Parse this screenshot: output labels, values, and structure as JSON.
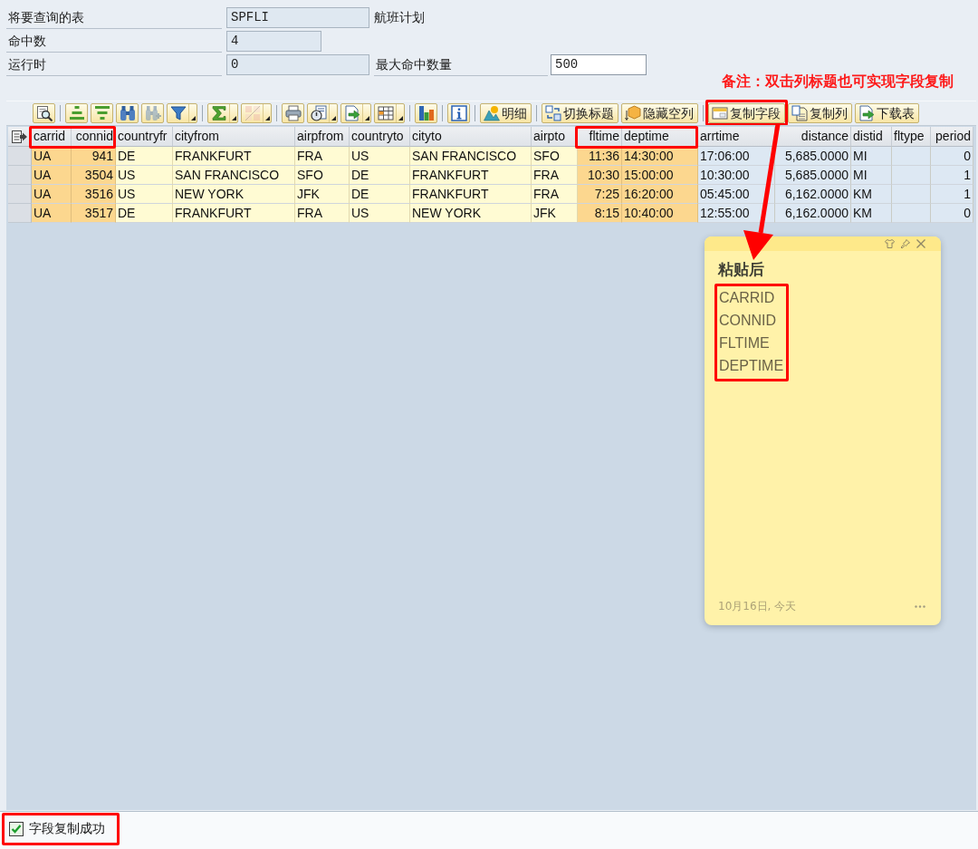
{
  "form": {
    "rows": [
      {
        "label": "将要查询的表",
        "field": {
          "value": "SPFLI",
          "editable": false
        },
        "description": "航班计划"
      },
      {
        "label": "命中数",
        "field": {
          "value": "4",
          "editable": false
        }
      },
      {
        "label": "运行时",
        "field": {
          "value": "0",
          "editable": false
        },
        "extra": {
          "label": "最大命中数量",
          "field": {
            "value": "500",
            "editable": true
          }
        }
      }
    ]
  },
  "annotation": {
    "text": "备注：双击列标题也可实现字段复制"
  },
  "toolbar": {
    "groups": [
      {
        "buttons": [
          {
            "kind": "icon",
            "menu": false,
            "disabled": false,
            "annotated": false
          }
        ]
      },
      {
        "buttons": [
          {
            "kind": "icon",
            "menu": false,
            "disabled": false,
            "annotated": false
          },
          {
            "kind": "icon",
            "menu": false,
            "disabled": false,
            "annotated": false
          },
          {
            "kind": "icon",
            "menu": false,
            "disabled": false,
            "annotated": false
          },
          {
            "kind": "icon",
            "menu": false,
            "disabled": true,
            "annotated": false
          },
          {
            "kind": "icon",
            "menu": true,
            "disabled": false,
            "annotated": false
          }
        ]
      },
      {
        "buttons": [
          {
            "kind": "icon",
            "menu": true,
            "disabled": false,
            "annotated": false
          },
          {
            "kind": "icon",
            "menu": true,
            "disabled": true,
            "annotated": false
          }
        ]
      },
      {
        "buttons": [
          {
            "kind": "icon",
            "menu": false,
            "disabled": false,
            "annotated": false
          },
          {
            "kind": "icon",
            "menu": true,
            "disabled": false,
            "annotated": false
          },
          {
            "kind": "icon",
            "menu": true,
            "disabled": false,
            "annotated": false
          },
          {
            "kind": "icon",
            "menu": true,
            "disabled": false,
            "annotated": false
          }
        ]
      },
      {
        "buttons": [
          {
            "kind": "icon",
            "menu": false,
            "disabled": false,
            "annotated": false
          }
        ]
      },
      {
        "buttons": [
          {
            "kind": "icon",
            "menu": false,
            "disabled": false,
            "annotated": false
          }
        ]
      },
      {
        "buttons": [
          {
            "kind": "text",
            "label": "明细",
            "menu": false,
            "disabled": false,
            "annotated": false
          }
        ]
      },
      {
        "buttons": [
          {
            "kind": "text",
            "label": "切换标题",
            "menu": false,
            "disabled": false,
            "annotated": false
          },
          {
            "kind": "text",
            "label": "隐藏空列",
            "menu": false,
            "disabled": false,
            "annotated": false
          }
        ]
      },
      {
        "buttons": [
          {
            "kind": "text",
            "label": "复制字段",
            "menu": false,
            "disabled": false,
            "annotated": true
          },
          {
            "kind": "text",
            "label": "复制列",
            "menu": false,
            "disabled": false,
            "annotated": false
          },
          {
            "kind": "text",
            "label": "下载表",
            "menu": false,
            "disabled": false,
            "annotated": false
          }
        ]
      }
    ]
  },
  "table": {
    "columns": [
      {
        "label": "carrid",
        "kind": "text",
        "color": "#fcd78f",
        "annotated": true
      },
      {
        "label": "connid",
        "kind": "number",
        "color": "#fcd78f",
        "annotated": true
      },
      {
        "label": "countryfr",
        "kind": "text",
        "color": "#fffbd3",
        "annotated": false
      },
      {
        "label": "cityfrom",
        "kind": "text",
        "color": "#fffbd3",
        "annotated": false
      },
      {
        "label": "airpfrom",
        "kind": "text",
        "color": "#fffbd3",
        "annotated": false
      },
      {
        "label": "countryto",
        "kind": "text",
        "color": "#fffbd3",
        "annotated": false
      },
      {
        "label": "cityto",
        "kind": "text",
        "color": "#fffbd3",
        "annotated": false
      },
      {
        "label": "airpto",
        "kind": "text",
        "color": "#fffbd3",
        "annotated": false
      },
      {
        "label": "fltime",
        "kind": "number",
        "color": "#fcd78f",
        "annotated": true
      },
      {
        "label": "deptime",
        "kind": "text",
        "color": "#fcd78f",
        "annotated": true
      },
      {
        "label": "arrtime",
        "kind": "text",
        "color": "#dde8f3",
        "annotated": false
      },
      {
        "label": "distance",
        "kind": "number",
        "color": "#dde8f3",
        "annotated": false
      },
      {
        "label": "distid",
        "kind": "text",
        "color": "#dde8f3",
        "annotated": false
      },
      {
        "label": "fltype",
        "kind": "text",
        "color": "#dde8f3",
        "annotated": false
      },
      {
        "label": "period",
        "kind": "number",
        "color": "#dde8f3",
        "annotated": false
      }
    ],
    "rows": [
      [
        "UA",
        "941",
        "DE",
        "FRANKFURT",
        "FRA",
        "US",
        "SAN FRANCISCO",
        "SFO",
        "11:36",
        "14:30:00",
        "17:06:00",
        "5,685.0000",
        "MI",
        null,
        "0"
      ],
      [
        "UA",
        "3504",
        "US",
        "SAN FRANCISCO",
        "SFO",
        "DE",
        "FRANKFURT",
        "FRA",
        "10:30",
        "15:00:00",
        "10:30:00",
        "5,685.0000",
        "MI",
        null,
        "1"
      ],
      [
        "UA",
        "3516",
        "US",
        "NEW YORK",
        "JFK",
        "DE",
        "FRANKFURT",
        "FRA",
        "7:25",
        "16:20:00",
        "05:45:00",
        "6,162.0000",
        "KM",
        null,
        "1"
      ],
      [
        "UA",
        "3517",
        "DE",
        "FRANKFURT",
        "FRA",
        "US",
        "NEW YORK",
        "JFK",
        "8:15",
        "10:40:00",
        "12:55:00",
        "6,162.0000",
        "KM",
        null,
        "0"
      ]
    ]
  },
  "sticky_note": {
    "title": "粘贴后",
    "lines": [
      "CARRID",
      "CONNID",
      "FLTIME",
      "DEPTIME"
    ],
    "lines_annotated": true,
    "date": "10月16日, 今天"
  },
  "status_bar": {
    "kind": "success",
    "message": "字段复制成功",
    "annotated": true
  }
}
